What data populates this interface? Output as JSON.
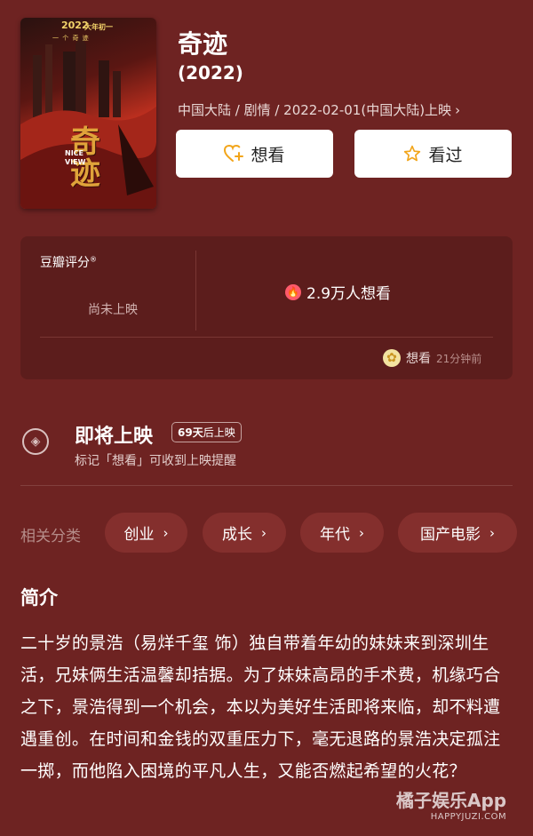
{
  "poster": {
    "year_text": "2022",
    "tag": "大年初一",
    "tagline": "一 个 奇 迹",
    "title_art": "奇迹",
    "en_title": "NICE VIEW"
  },
  "movie": {
    "title": "奇迹",
    "year": "(2022)",
    "meta": "中国大陆 / 剧情 / 2022-02-01(中国大陆)上映"
  },
  "actions": {
    "want_label": "想看",
    "seen_label": "看过"
  },
  "rating": {
    "label": "豆瓣评分",
    "status": "尚未上映",
    "want_count": "2.9万人想看",
    "recent_action": "想看",
    "recent_time": "21分钟前"
  },
  "coming_soon": {
    "title": "即将上映",
    "days_number": "69天",
    "days_suffix": "后上映",
    "subtitle": "标记「想看」可收到上映提醒"
  },
  "categories": {
    "label": "相关分类",
    "items": [
      "创业",
      "成长",
      "年代",
      "国产电影"
    ]
  },
  "intro": {
    "title": "简介",
    "text": "二十岁的景浩（易烊千玺 饰）独自带着年幼的妹妹来到深圳生活，兄妹俩生活温馨却拮据。为了妹妹高昂的手术费，机缘巧合之下，景浩得到一个机会，本以为美好生活即将来临，却不料遭遇重创。在时间和金钱的双重压力下，毫无退路的景浩决定孤注一掷，而他陷入困境的平凡人生，又能否燃起希望的火花？"
  },
  "watermark": {
    "cn": "橘子娱乐App",
    "en": "HAPPYJUZI.COM"
  },
  "colors": {
    "background": "#6e2322",
    "card": "#5c1d1c",
    "chip": "#842f2d",
    "accent": "#f2a51a"
  },
  "icons": [
    "heart-plus-icon",
    "star-icon",
    "fire-icon",
    "avatar",
    "ticket-icon",
    "chevron-right-icon"
  ]
}
